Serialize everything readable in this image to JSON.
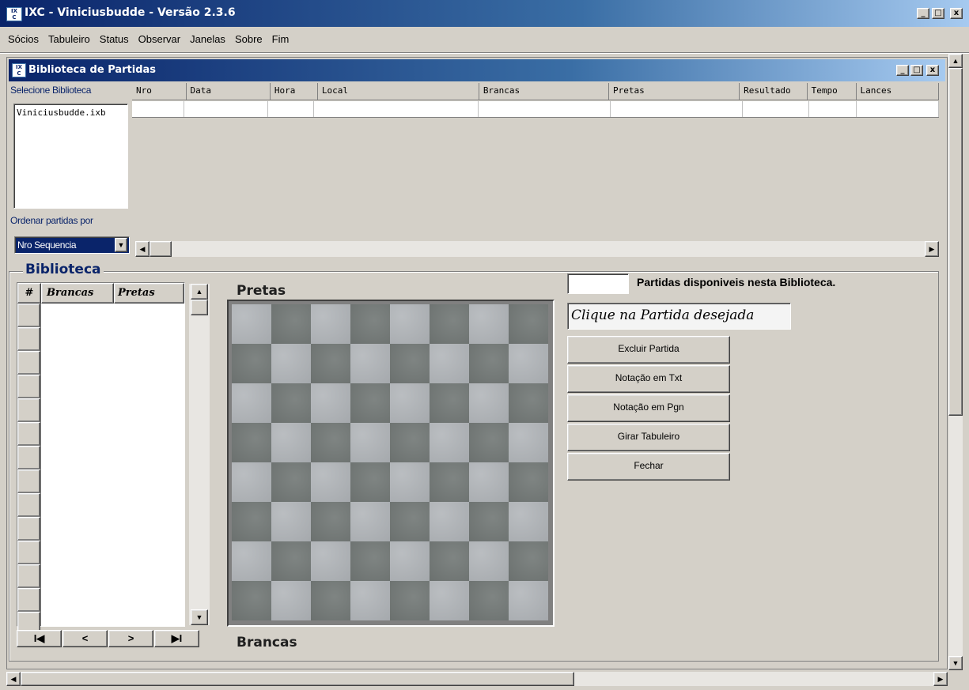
{
  "app": {
    "title": "IXC - Viniciusbudde - Versão 2.3.6"
  },
  "menu": [
    "Sócios",
    "Tabuleiro",
    "Status",
    "Observar",
    "Janelas",
    "Sobre",
    "Fim"
  ],
  "window_controls": {
    "minimize": "_",
    "maximize": "□",
    "close": "x"
  },
  "child_window": {
    "title": "Biblioteca de Partidas"
  },
  "library": {
    "select_label": "Selecione Biblioteca",
    "files": [
      "Viniciusbudde.ixb"
    ],
    "sort_label": "Ordenar partidas por",
    "sort_value": "Nro Sequencia"
  },
  "games_table": {
    "columns": [
      "Nro",
      "Data",
      "Hora",
      "Local",
      "Brancas",
      "Pretas",
      "Resultado",
      "Tempo",
      "Lances"
    ]
  },
  "biblioteca": {
    "title": "Biblioteca",
    "columns": [
      "#",
      "Brancas",
      "Pretas"
    ],
    "nav": [
      "I◀",
      "<",
      ">",
      "▶I"
    ]
  },
  "board": {
    "top_label": "Pretas",
    "bottom_label": "Brancas"
  },
  "panel": {
    "count_value": "",
    "available_text": "Partidas disponiveis nesta Biblioteca.",
    "hint": "Clique na Partida desejada",
    "buttons": [
      "Excluir Partida",
      "Notação em Txt",
      "Notação em Pgn",
      "Girar Tabuleiro",
      "Fechar"
    ]
  },
  "icons": {
    "app": "ixc-logo-icon",
    "scroll_up": "▲",
    "scroll_down": "▼",
    "scroll_left": "◀",
    "scroll_right": "▶"
  }
}
